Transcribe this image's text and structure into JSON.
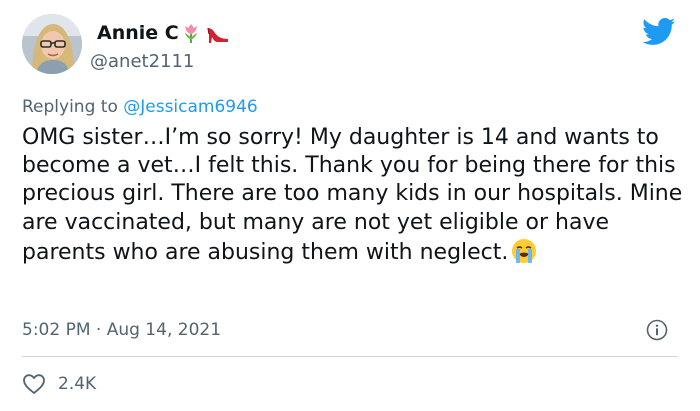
{
  "user": {
    "display_name": "Annie C",
    "handle": "@anet2111",
    "badges": [
      "tulip-icon",
      "high-heel-icon"
    ]
  },
  "reply": {
    "prefix": "Replying to",
    "mention": "@Jessicam6946"
  },
  "tweet": {
    "text": "OMG sister…I’m so sorry! My daughter is 14 and wants to become a vet…I felt this. Thank you for being there for this precious girl. There are too many kids in our hospitals. Mine are vaccinated, but many are not yet eligible or have parents who are abusing them with neglect.",
    "trailing_emoji": "loudly-crying-face-icon",
    "timestamp": "5:02 PM · Aug 14, 2021"
  },
  "stats": {
    "likes": "2.4K"
  },
  "colors": {
    "brand": "#1d9bf0",
    "text": "#0f1419",
    "muted": "#536471",
    "divider": "#cfd9de"
  }
}
